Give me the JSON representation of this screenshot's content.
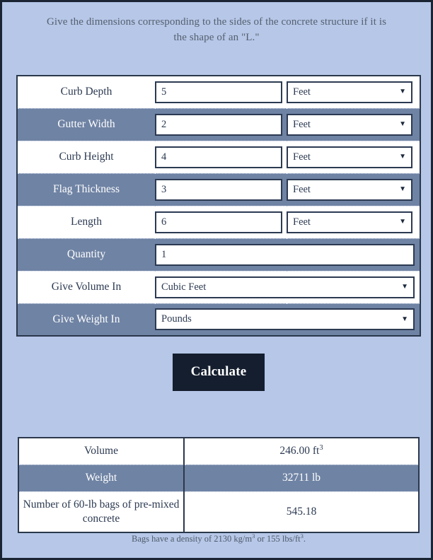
{
  "page": {
    "prompt": "Give the dimensions corresponding to the sides of the concrete structure if it is the shape of an \"L.\"",
    "background_color": "#b6c7e8",
    "stripe_color": "#6f83a4",
    "border_color": "#1a2433",
    "button_color": "#141e2e"
  },
  "form": {
    "rows": [
      {
        "label": "Curb Depth",
        "value": "5",
        "unit": "Feet",
        "has_unit": true
      },
      {
        "label": "Gutter Width",
        "value": "2",
        "unit": "Feet",
        "has_unit": true
      },
      {
        "label": "Curb Height",
        "value": "4",
        "unit": "Feet",
        "has_unit": true
      },
      {
        "label": "Flag Thickness",
        "value": "3",
        "unit": "Feet",
        "has_unit": true
      },
      {
        "label": "Length",
        "value": "6",
        "unit": "Feet",
        "has_unit": true
      },
      {
        "label": "Quantity",
        "value": "1",
        "unit": "",
        "has_unit": false
      }
    ],
    "selects": [
      {
        "label": "Give Volume In",
        "value": "Cubic Feet"
      },
      {
        "label": "Give Weight In",
        "value": "Pounds"
      }
    ],
    "caret_glyph": "▼"
  },
  "actions": {
    "calculate_label": "Calculate"
  },
  "results": {
    "rows": [
      {
        "label": "Volume",
        "value_number": "246.00 ft",
        "value_sup": "3"
      },
      {
        "label": "Weight",
        "value_number": "32711 lb",
        "value_sup": ""
      },
      {
        "label": "Number of 60-lb bags of pre-mixed concrete",
        "value_number": "545.18",
        "value_sup": ""
      }
    ]
  },
  "footnote": {
    "text_before": "Bags have a density of 2130 kg/m",
    "sup_1": "3",
    "text_mid": " or 155 lbs/ft",
    "sup_2": "3",
    "text_after": "."
  }
}
